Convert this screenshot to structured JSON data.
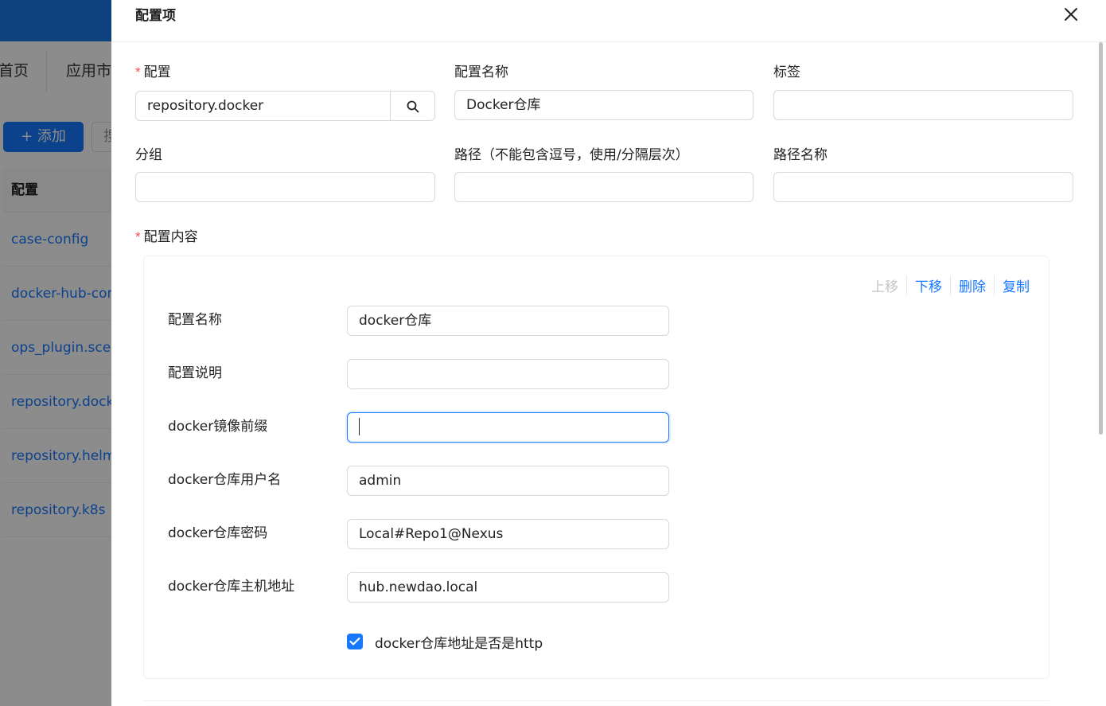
{
  "background": {
    "tabs": [
      "首页",
      "应用市场"
    ],
    "add_button": "+ 添加",
    "second_button": "搜",
    "table_header": "配置",
    "rows": [
      "case-config",
      "docker-hub-config",
      "ops_plugin.scene",
      "repository.docker",
      "repository.helm",
      "repository.k8s"
    ]
  },
  "drawer": {
    "title": "配置项",
    "close_icon": "close-icon",
    "fields": {
      "config": {
        "label": "配置",
        "value": "repository.docker",
        "required": "*"
      },
      "config_name": {
        "label": "配置名称",
        "value": "Docker仓库"
      },
      "tags": {
        "label": "标签",
        "value": ""
      },
      "group": {
        "label": "分组",
        "value": ""
      },
      "path": {
        "label": "路径（不能包含逗号，使用/分隔层次）",
        "value": ""
      },
      "path_name": {
        "label": "路径名称",
        "value": ""
      }
    },
    "content": {
      "label": "配置内容",
      "required": "*",
      "actions": {
        "up": "上移",
        "down": "下移",
        "delete": "删除",
        "copy": "复制"
      },
      "rows": [
        {
          "label": "配置名称",
          "value": "docker仓库"
        },
        {
          "label": "配置说明",
          "value": ""
        },
        {
          "label": "docker镜像前缀",
          "value": ""
        },
        {
          "label": "docker仓库用户名",
          "value": "admin"
        },
        {
          "label": "docker仓库密码",
          "value": "Local#Repo1@Nexus"
        },
        {
          "label": "docker仓库主机地址",
          "value": "hub.newdao.local"
        }
      ],
      "checkbox_label": "docker仓库地址是否是http",
      "checkbox_checked": true
    }
  },
  "colors": {
    "primary": "#1677ff",
    "required": "#ff4d4f",
    "topbar": "#1677e6"
  }
}
